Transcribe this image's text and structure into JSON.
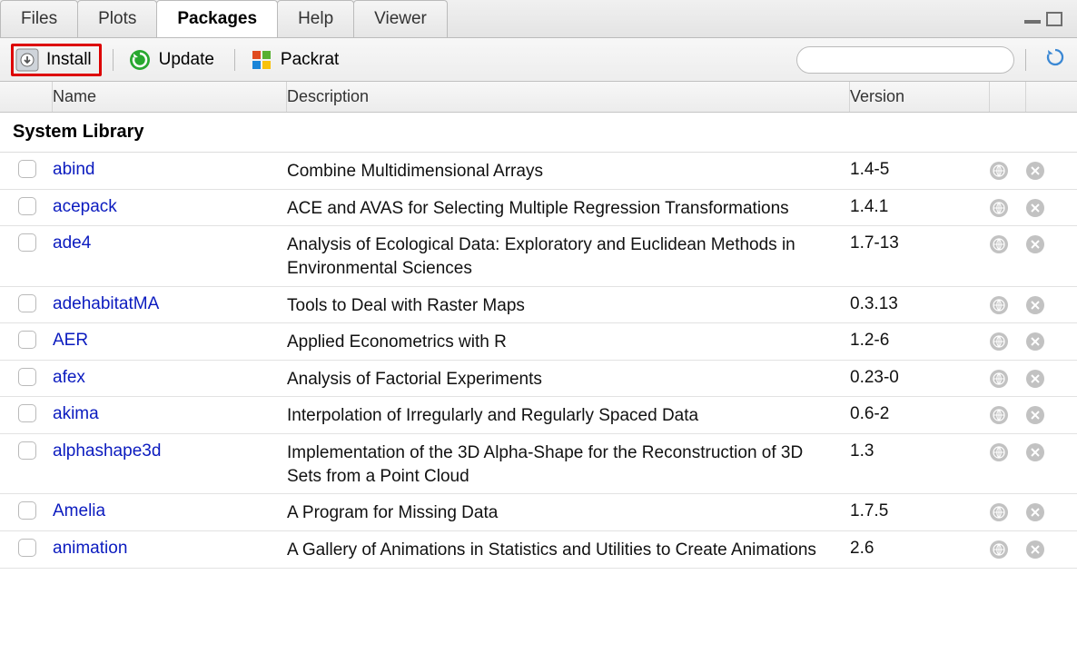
{
  "tabs": [
    {
      "label": "Files",
      "active": false
    },
    {
      "label": "Plots",
      "active": false
    },
    {
      "label": "Packages",
      "active": true
    },
    {
      "label": "Help",
      "active": false
    },
    {
      "label": "Viewer",
      "active": false
    }
  ],
  "toolbar": {
    "install_label": "Install",
    "update_label": "Update",
    "packrat_label": "Packrat",
    "search_placeholder": ""
  },
  "columns": {
    "name": "Name",
    "description": "Description",
    "version": "Version"
  },
  "section_title": "System Library",
  "packages": [
    {
      "name": "abind",
      "description": "Combine Multidimensional Arrays",
      "version": "1.4-5"
    },
    {
      "name": "acepack",
      "description": "ACE and AVAS for Selecting Multiple Regression Transformations",
      "version": "1.4.1"
    },
    {
      "name": "ade4",
      "description": "Analysis of Ecological Data: Exploratory and Euclidean Methods in Environmental Sciences",
      "version": "1.7-13"
    },
    {
      "name": "adehabitatMA",
      "description": "Tools to Deal with Raster Maps",
      "version": "0.3.13"
    },
    {
      "name": "AER",
      "description": "Applied Econometrics with R",
      "version": "1.2-6"
    },
    {
      "name": "afex",
      "description": "Analysis of Factorial Experiments",
      "version": "0.23-0"
    },
    {
      "name": "akima",
      "description": "Interpolation of Irregularly and Regularly Spaced Data",
      "version": "0.6-2"
    },
    {
      "name": "alphashape3d",
      "description": "Implementation of the 3D Alpha-Shape for the Reconstruction of 3D Sets from a Point Cloud",
      "version": "1.3"
    },
    {
      "name": "Amelia",
      "description": "A Program for Missing Data",
      "version": "1.7.5"
    },
    {
      "name": "animation",
      "description": "A Gallery of Animations in Statistics and Utilities to Create Animations",
      "version": "2.6"
    }
  ]
}
